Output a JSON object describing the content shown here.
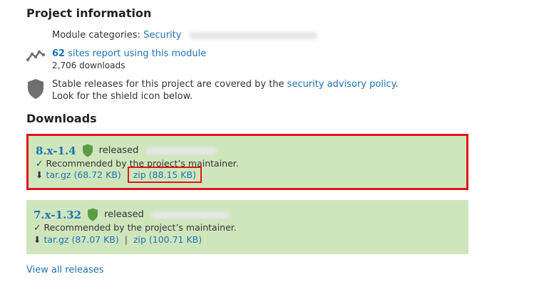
{
  "project_info": {
    "heading": "Project information",
    "module_categories_label": "Module categories:",
    "module_categories_link": "Security",
    "sites_count": "62",
    "sites_text": " sites report using this module",
    "downloads": "2,706 downloads",
    "security_text_pre": "Stable releases for this project are covered by the ",
    "security_link": "security advisory policy",
    "security_text_post": ".",
    "security_text_line2": "Look for the shield icon below."
  },
  "downloads": {
    "heading": "Downloads",
    "releases": [
      {
        "version": "8.x-1.4",
        "released_label": "released",
        "recommended_text": "✓ Recommended by the project’s maintainer.",
        "download_arrow": "⬇",
        "tar_label": "tar.gz (68.72 KB)",
        "zip_label": "zip (88.15 KB)"
      },
      {
        "version": "7.x-1.32",
        "released_label": "released",
        "recommended_text": "✓ Recommended by the project’s maintainer.",
        "download_arrow": "⬇",
        "tar_label": "tar.gz (87.07 KB)",
        "separator": "|",
        "zip_label": "zip (100.71 KB)"
      }
    ],
    "view_all": "View all releases"
  },
  "colors": {
    "link": "#1e73b2",
    "release_bg": "#cfe6bd",
    "highlight_red": "#e3151a",
    "shield_green": "#5c9b45",
    "shield_gray": "#6f6f6f"
  },
  "icons": {
    "sites_icon": "activity-graph-icon",
    "security_icon": "shield-icon",
    "release_icon": "green-shield-icon"
  }
}
